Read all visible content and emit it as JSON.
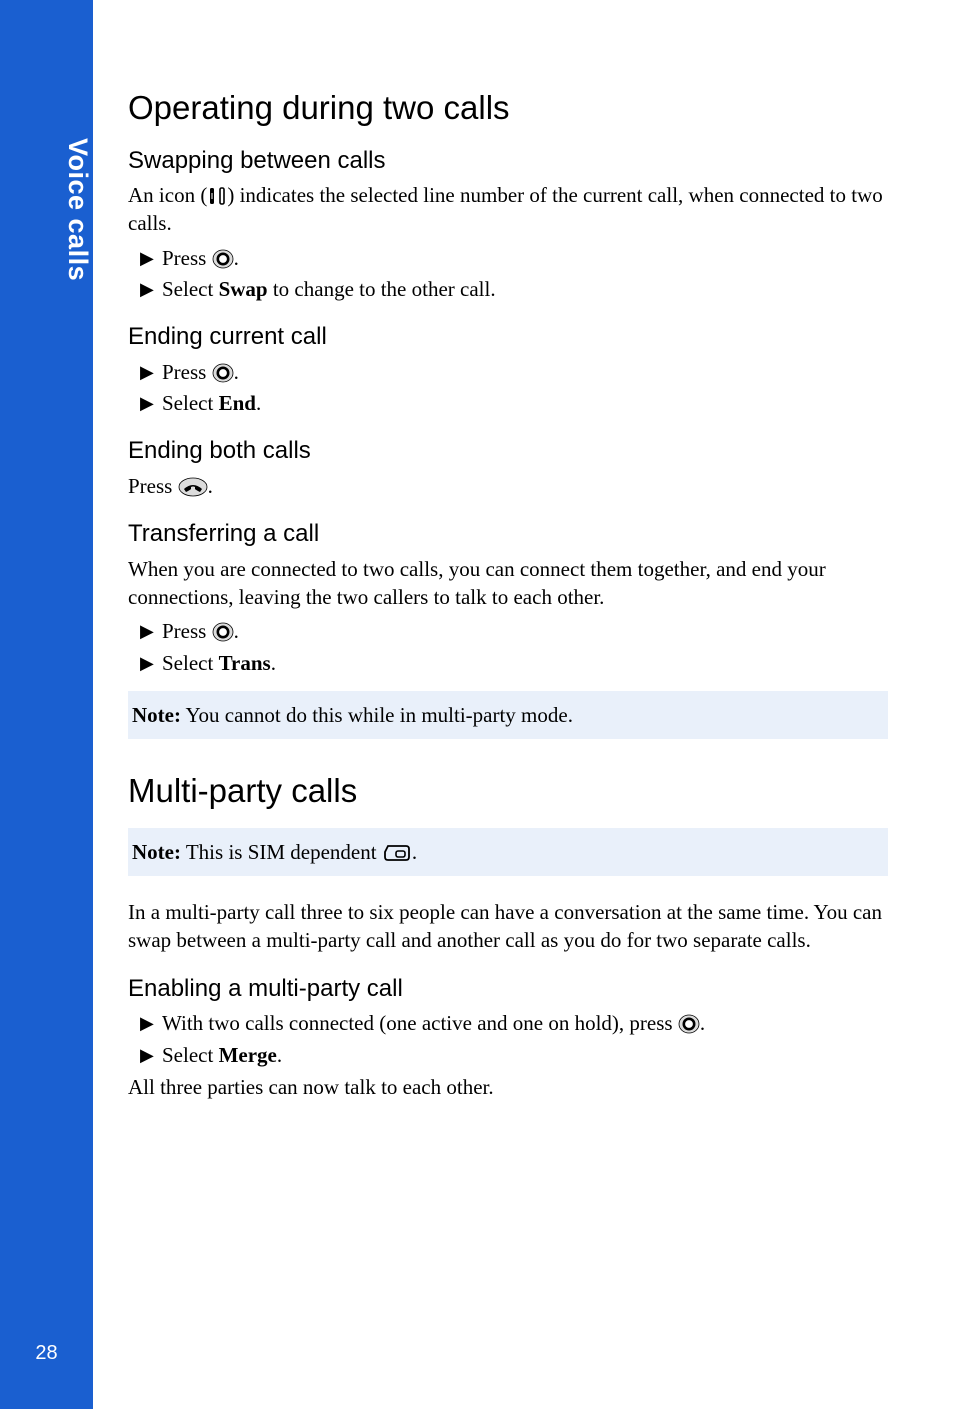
{
  "sidebar": {
    "label": "Voice calls",
    "page_number": "28"
  },
  "sections": {
    "operating": {
      "title": "Operating during two calls",
      "swapping": {
        "heading": "Swapping between calls",
        "intro_pre": "An icon (",
        "intro_post": ") indicates the selected line number of the current call, when connected to two calls.",
        "step1_pre": "Press ",
        "step1_post": ".",
        "step2_pre": "Select ",
        "step2_bold": "Swap",
        "step2_post": " to change to the other call."
      },
      "ending_current": {
        "heading": "Ending current call",
        "step1_pre": "Press ",
        "step1_post": ".",
        "step2_pre": "Select ",
        "step2_bold": "End",
        "step2_post": "."
      },
      "ending_both": {
        "heading": "Ending both calls",
        "line_pre": "Press ",
        "line_post": "."
      },
      "transferring": {
        "heading": "Transferring a call",
        "intro": "When you are connected to two calls, you can connect them together, and end your connections, leaving the two callers to talk to each other.",
        "step1_pre": "Press ",
        "step1_post": ".",
        "step2_pre": "Select ",
        "step2_bold": "Trans",
        "step2_post": ".",
        "note_bold": "Note:",
        "note_text": " You cannot do this while in multi-party mode."
      }
    },
    "multiparty": {
      "title": "Multi-party calls",
      "note_bold": "Note:",
      "note_text_pre": " This is SIM dependent ",
      "note_text_post": ".",
      "intro": "In a multi-party call three to six people can have a conversation at the same time. You can swap between a multi-party call and another call as you do for two separate calls.",
      "enabling": {
        "heading": "Enabling a multi-party call",
        "step1_pre": "With two calls connected (one active and one on hold), press ",
        "step1_post": ".",
        "step2_pre": "Select ",
        "step2_bold": "Merge",
        "step2_post": ".",
        "outro": "All three parties can now talk to each other."
      }
    }
  }
}
